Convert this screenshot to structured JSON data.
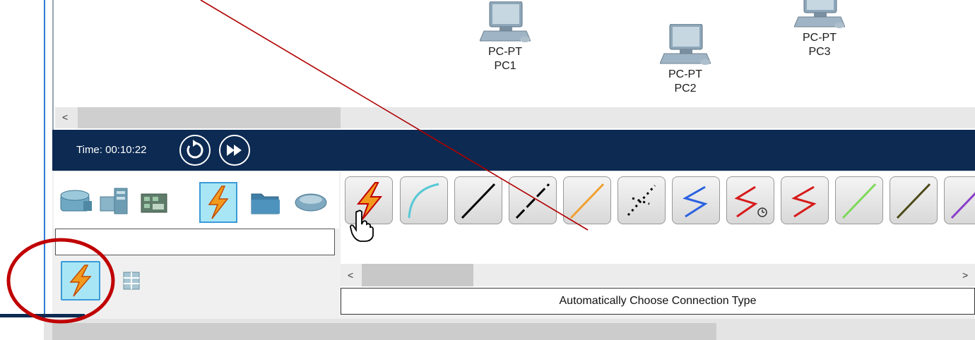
{
  "devices": [
    {
      "type": "PC-PT",
      "name": "PC1"
    },
    {
      "type": "PC-PT",
      "name": "PC2"
    },
    {
      "type": "PC-PT",
      "name": "PC3"
    }
  ],
  "scroll": {
    "left_arrow": "<",
    "right_arrow": ">"
  },
  "timebar": {
    "time_text": "Time: 00:10:22"
  },
  "device_categories": [
    "router-icon",
    "switch-icon",
    "hub-icon",
    "connections-icon",
    "end-devices-icon",
    "wan-emulation-icon"
  ],
  "cables": [
    "automatic",
    "console",
    "copper-straight",
    "copper-cross",
    "crossover-orange",
    "phone",
    "serial-dce-blue",
    "serial-dce-clock",
    "serial-dte-red",
    "coaxial-green",
    "octal",
    "fiber-purple"
  ],
  "status": {
    "label": "Automatically Choose Connection Type"
  },
  "colors": {
    "accent": "#2b7bd6",
    "navy": "#0c2a52",
    "highlight_circle": "#c00000",
    "annotation_line": "#b00000"
  }
}
